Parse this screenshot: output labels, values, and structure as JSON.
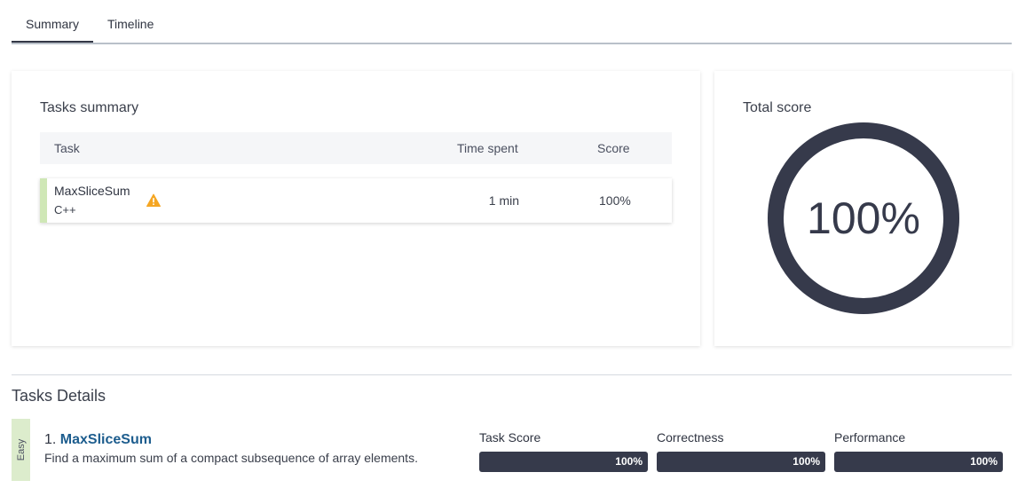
{
  "tabs": [
    {
      "label": "Summary",
      "active": true
    },
    {
      "label": "Timeline",
      "active": false
    }
  ],
  "tasks_summary": {
    "title": "Tasks summary",
    "columns": {
      "task": "Task",
      "time": "Time spent",
      "score": "Score"
    },
    "rows": [
      {
        "name": "MaxSliceSum",
        "language": "C++",
        "warning_icon": "warning-triangle-icon",
        "time": "1 min",
        "score": "100%"
      }
    ]
  },
  "total_score": {
    "title": "Total score",
    "value": "100%",
    "fraction": 1.0
  },
  "tasks_details": {
    "title": "Tasks Details",
    "tasks": [
      {
        "difficulty": "Easy",
        "number": "1.",
        "name": "MaxSliceSum",
        "description": "Find a maximum sum of a compact subsequence of array elements.",
        "metrics": [
          {
            "label": "Task Score",
            "value": "100%",
            "fraction": 1.0
          },
          {
            "label": "Correctness",
            "value": "100%",
            "fraction": 1.0
          },
          {
            "label": "Performance",
            "value": "100%",
            "fraction": 1.0
          }
        ]
      }
    ]
  },
  "colors": {
    "accent": "#363a4b",
    "easy": "#dceccc",
    "link": "#1d5d8e",
    "warning": "#f5a623"
  }
}
